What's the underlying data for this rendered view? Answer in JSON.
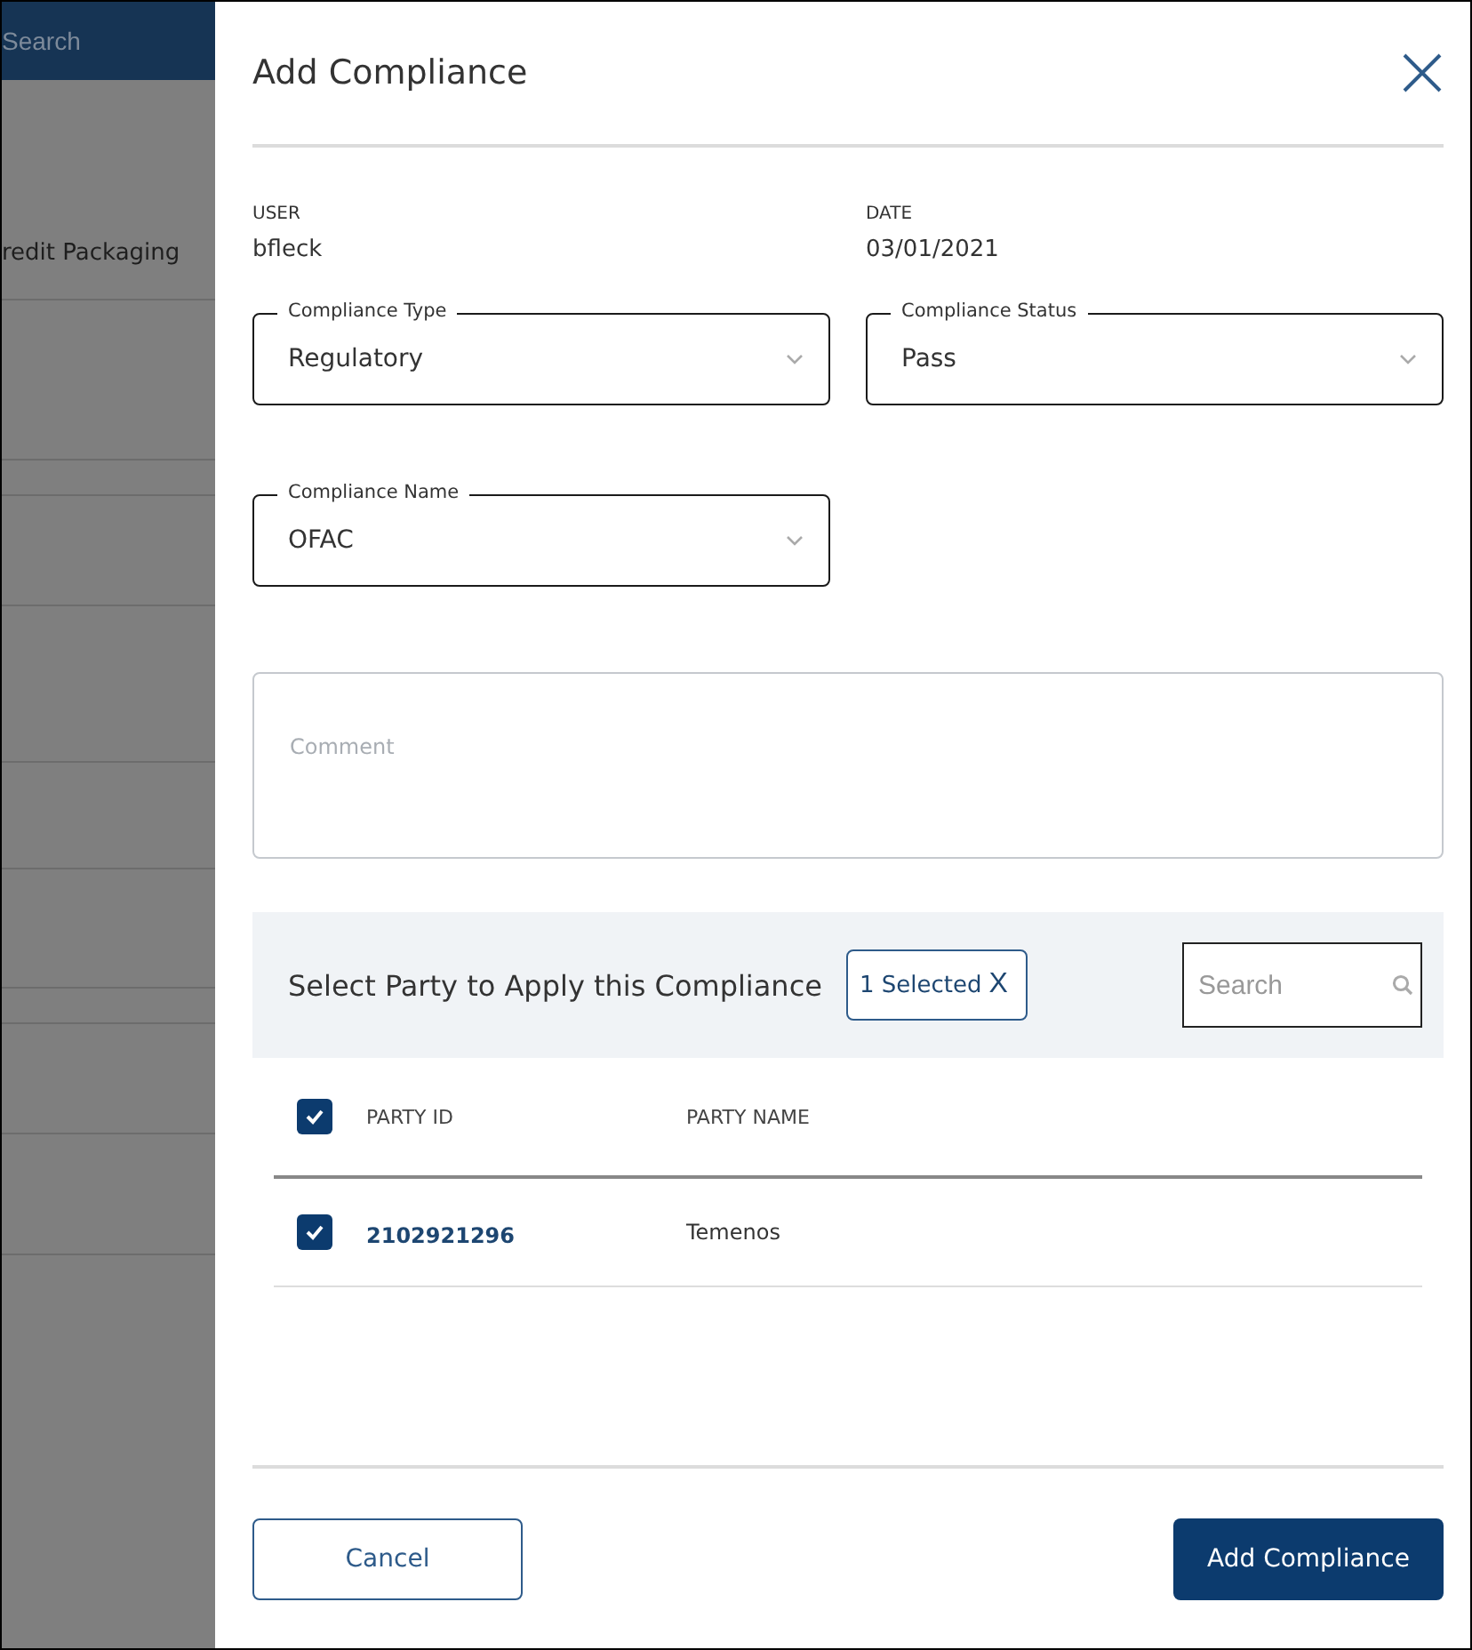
{
  "background": {
    "search_placeholder": "Search",
    "row_label": "redit Packaging"
  },
  "drawer": {
    "title": "Add Compliance",
    "info": [
      {
        "label": "USER",
        "value": "bfleck"
      },
      {
        "label": "DATE",
        "value": "03/01/2021"
      }
    ],
    "selects": [
      {
        "label": "Compliance Type",
        "value": "Regulatory"
      },
      {
        "label": "Compliance Status",
        "value": "Pass"
      },
      {
        "label": "Compliance Name",
        "value": "OFAC"
      }
    ],
    "comment": {
      "placeholder": "Comment"
    },
    "party": {
      "title": "Select Party to Apply this Compliance",
      "selected_chip": "1 Selected",
      "chip_clear": "X",
      "search_placeholder": "Search",
      "columns": [
        "PARTY ID",
        "PARTY NAME"
      ],
      "all_checked": true,
      "rows": [
        {
          "id": "2102921296",
          "name": "Temenos",
          "checked": true
        }
      ]
    },
    "buttons": [
      {
        "label": "Cancel",
        "kind": "secondary"
      },
      {
        "label": "Add Compliance",
        "kind": "primary"
      }
    ]
  }
}
